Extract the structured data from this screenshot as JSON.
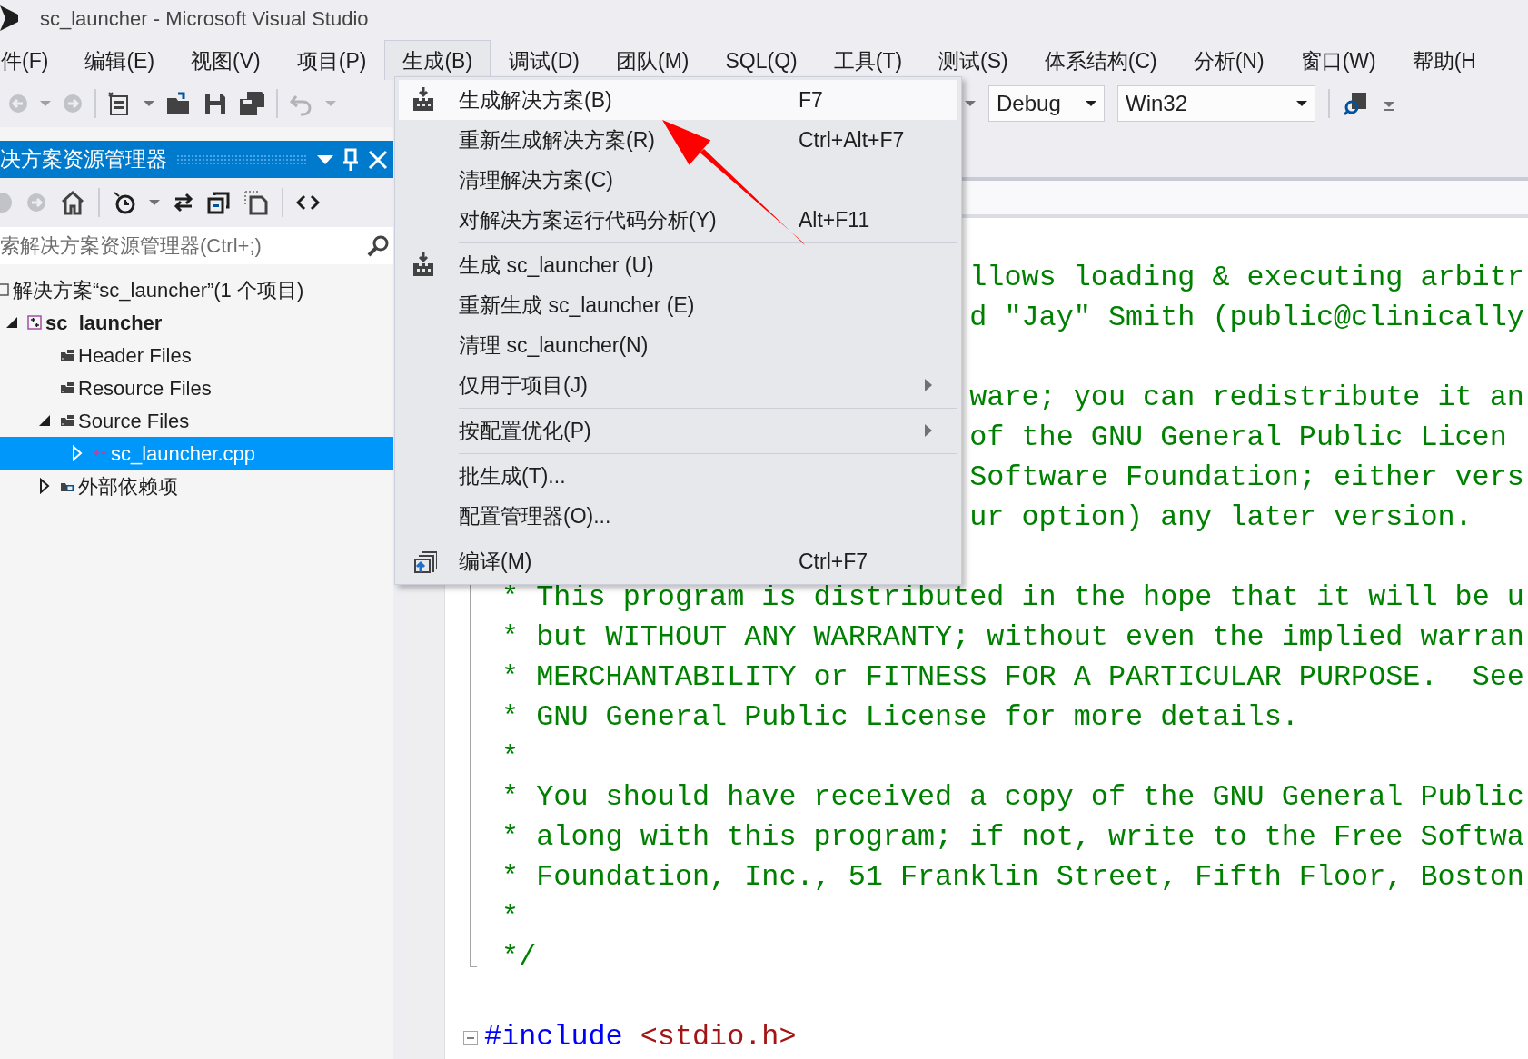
{
  "window": {
    "title": "sc_launcher - Microsoft Visual Studio"
  },
  "menu_bar": [
    {
      "label": "件(F)",
      "selected": false
    },
    {
      "label": "编辑(E)",
      "selected": false
    },
    {
      "label": "视图(V)",
      "selected": false
    },
    {
      "label": "项目(P)",
      "selected": false
    },
    {
      "label": "生成(B)",
      "selected": true
    },
    {
      "label": "调试(D)",
      "selected": false
    },
    {
      "label": "团队(M)",
      "selected": false
    },
    {
      "label": "SQL(Q)",
      "selected": false
    },
    {
      "label": "工具(T)",
      "selected": false
    },
    {
      "label": "测试(S)",
      "selected": false
    },
    {
      "label": "体系结构(C)",
      "selected": false
    },
    {
      "label": "分析(N)",
      "selected": false
    },
    {
      "label": "窗口(W)",
      "selected": false
    },
    {
      "label": "帮助(H",
      "selected": false
    }
  ],
  "toolbar": {
    "configuration": "Debug",
    "platform": "Win32"
  },
  "build_menu": {
    "groups": [
      [
        {
          "label": "生成解决方案(B)",
          "shortcut": "F7",
          "kind": "build",
          "selected": true
        },
        {
          "label": "重新生成解决方案(R)",
          "shortcut": "Ctrl+Alt+F7",
          "kind": "command",
          "selected": false
        },
        {
          "label": "清理解决方案(C)",
          "kind": "command",
          "selected": false
        },
        {
          "label": "对解决方案运行代码分析(Y)",
          "shortcut": "Alt+F11",
          "kind": "command",
          "selected": false
        }
      ],
      [
        {
          "label": "生成 sc_launcher (U)",
          "kind": "build",
          "selected": false
        },
        {
          "label": "重新生成 sc_launcher (E)",
          "kind": "command",
          "selected": false
        },
        {
          "label": "清理 sc_launcher(N)",
          "kind": "command",
          "selected": false
        },
        {
          "label": "仅用于项目(J)",
          "kind": "submenu",
          "selected": false
        }
      ],
      [
        {
          "label": "按配置优化(P)",
          "kind": "submenu",
          "selected": false
        }
      ],
      [
        {
          "label": "批生成(T)...",
          "kind": "command",
          "selected": false
        },
        {
          "label": "配置管理器(O)...",
          "kind": "command",
          "selected": false
        }
      ],
      [
        {
          "label": "编译(M)",
          "shortcut": "Ctrl+F7",
          "kind": "compile",
          "selected": false
        }
      ]
    ]
  },
  "solution_explorer": {
    "title": "决方案资源管理器",
    "search": {
      "placeholder": "索解决方案资源管理器(Ctrl+;)"
    },
    "tree": [
      {
        "label": "解决方案“sc_launcher”(1 个项目)",
        "kind": "solution",
        "selected": false,
        "children": [
          {
            "label": "sc_launcher",
            "kind": "project",
            "expanded": true,
            "selected": false,
            "children": [
              {
                "label": "Header Files",
                "kind": "filter",
                "selected": false
              },
              {
                "label": "Resource Files",
                "kind": "filter",
                "selected": false
              },
              {
                "label": "Source Files",
                "kind": "filter",
                "expanded": true,
                "selected": false,
                "children": [
                  {
                    "label": "sc_launcher.cpp",
                    "kind": "file",
                    "expanded": false,
                    "selected": true
                  }
                ]
              },
              {
                "label": "外部依赖项",
                "kind": "dependencies",
                "expanded": false,
                "selected": false
              }
            ]
          }
        ]
      }
    ]
  },
  "editor": {
    "lines": [
      {
        "kind": "clipped",
        "text": "llows loading & executing arbitr"
      },
      {
        "kind": "clipped",
        "text": "d \"Jay\" Smith (public@clinically"
      },
      {
        "kind": "blank"
      },
      {
        "kind": "clipped",
        "text": "ware; you can redistribute it an"
      },
      {
        "kind": "clipped",
        "text": "of the GNU General Public Licen"
      },
      {
        "kind": "clipped",
        "text": "Software Foundation; either vers"
      },
      {
        "kind": "clipped",
        "text": "ur option) any later version."
      },
      {
        "kind": "blank"
      },
      {
        "kind": "comment",
        "text": "* This program is distributed in the hope that it will be u"
      },
      {
        "kind": "comment",
        "text": "* but WITHOUT ANY WARRANTY; without even the implied warran"
      },
      {
        "kind": "comment",
        "text": "* MERCHANTABILITY or FITNESS FOR A PARTICULAR PURPOSE.  See"
      },
      {
        "kind": "comment",
        "text": "* GNU General Public License for more details."
      },
      {
        "kind": "comment",
        "text": "*"
      },
      {
        "kind": "comment",
        "text": "* You should have received a copy of the GNU General Public"
      },
      {
        "kind": "comment",
        "text": "* along with this program; if not, write to the Free Softwa"
      },
      {
        "kind": "comment",
        "text": "* Foundation, Inc., 51 Franklin Street, Fifth Floor, Boston,"
      },
      {
        "kind": "comment",
        "text": "*"
      },
      {
        "kind": "comment_end",
        "text": "*/"
      },
      {
        "kind": "blank"
      },
      {
        "kind": "directive",
        "tokens": [
          {
            "kind": "keyword",
            "text": "#include"
          },
          {
            "kind": "string",
            "text": "<stdio.h>"
          }
        ]
      }
    ]
  }
}
